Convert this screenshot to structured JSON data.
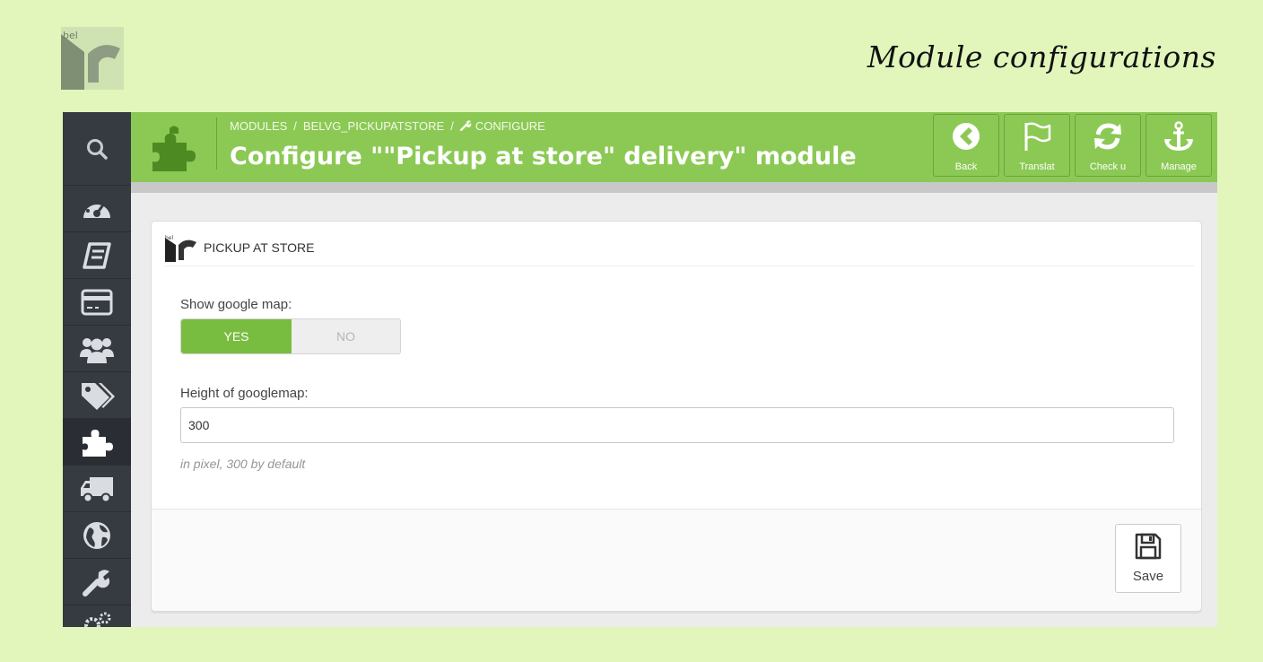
{
  "banner": {
    "title": "Module configurations",
    "logo_icon": "belvg-logo"
  },
  "sidebar": {
    "search_icon": "search-icon",
    "items": [
      {
        "icon": "dashboard-icon",
        "active": false
      },
      {
        "icon": "catalog-icon",
        "active": false
      },
      {
        "icon": "orders-icon",
        "active": false
      },
      {
        "icon": "customers-icon",
        "active": false
      },
      {
        "icon": "price-rules-icon",
        "active": false
      },
      {
        "icon": "modules-icon",
        "active": true
      },
      {
        "icon": "shipping-icon",
        "active": false
      },
      {
        "icon": "localization-icon",
        "active": false
      },
      {
        "icon": "preferences-icon",
        "active": false
      },
      {
        "icon": "advanced-parameters-icon",
        "active": false
      }
    ]
  },
  "header": {
    "breadcrumb": [
      "MODULES",
      "BELVG_PICKUPATSTORE",
      "CONFIGURE"
    ],
    "breadcrumb_separator": "/",
    "title": "Configure \"\"Pickup at store\" delivery\" module",
    "toolbar": [
      {
        "label": "Back",
        "icon": "back-arrow-icon"
      },
      {
        "label": "Translat",
        "icon": "flag-icon"
      },
      {
        "label": "Check u",
        "icon": "refresh-icon"
      },
      {
        "label": "Manage",
        "icon": "anchor-icon"
      }
    ],
    "accent_color": "#8bc954"
  },
  "panel": {
    "title": "PICKUP AT STORE",
    "fields": {
      "show_map": {
        "label": "Show google map:",
        "yes": "YES",
        "no": "NO",
        "value": "YES"
      },
      "height": {
        "label": "Height of googlemap:",
        "value": "300",
        "help": "in pixel, 300 by default"
      }
    },
    "save_label": "Save"
  }
}
